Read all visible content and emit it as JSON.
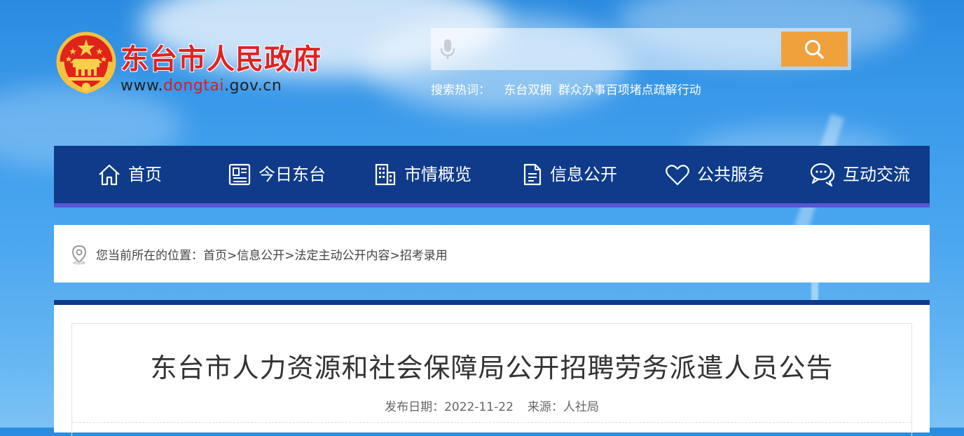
{
  "header": {
    "site_title": "东台市人民政府",
    "url_prefix": "www.",
    "url_highlight": "dongtai",
    "url_suffix": ".gov.cn",
    "emblem_icon": "national-emblem-icon"
  },
  "search": {
    "value": "",
    "placeholder": "",
    "hot_label": "搜索热词：",
    "hot_words": [
      "东台双拥",
      "群众办事百项堵点疏解行动"
    ]
  },
  "nav": {
    "items": [
      {
        "label": "首页",
        "icon": "home-icon"
      },
      {
        "label": "今日东台",
        "icon": "newspaper-icon"
      },
      {
        "label": "市情概览",
        "icon": "building-icon"
      },
      {
        "label": "信息公开",
        "icon": "document-icon"
      },
      {
        "label": "公共服务",
        "icon": "heart-icon"
      },
      {
        "label": "互动交流",
        "icon": "chat-icon"
      }
    ]
  },
  "breadcrumb": {
    "prefix": "您当前所在的位置：",
    "items": [
      "首页",
      "信息公开",
      "法定主动公开内容",
      "招考录用"
    ],
    "separator": ">"
  },
  "article": {
    "title": "东台市人力资源和社会保障局公开招聘劳务派遣人员公告",
    "date_label": "发布日期：",
    "date": "2022-11-22",
    "source_label": "来源：",
    "source": "人社局"
  },
  "colors": {
    "nav_bg": "#0f3b8a",
    "nav_underline": "#5b55d6",
    "search_button": "#f1a13c",
    "title_red": "#e02323"
  }
}
